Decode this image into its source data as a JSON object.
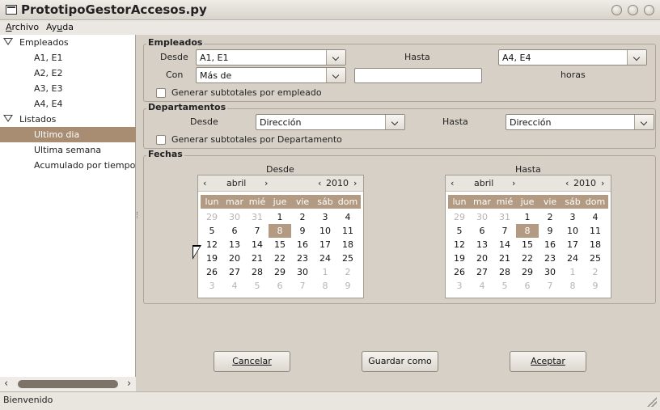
{
  "window": {
    "title": "PrototipoGestorAccesos.py"
  },
  "menu": [
    {
      "label": "Archivo",
      "mnemonic": "A",
      "rest": "rchivo"
    },
    {
      "label": "Ayuda",
      "mnemonic": "u",
      "pre": "Ay",
      "rest": "da"
    }
  ],
  "tree": {
    "empleados": "Empleados",
    "empleados_children": [
      "A1, E1",
      "A2, E2",
      "A3, E3",
      "A4, E4"
    ],
    "listados": "Listados",
    "listados_children": [
      "Ultimo dia",
      "Ultima semana",
      "Acumulado por tiempo"
    ],
    "selected": "Ultimo dia"
  },
  "empleados": {
    "title": "Empleados",
    "desde_label": "Desde",
    "desde_value": "A1, E1",
    "hasta_label": "Hasta",
    "hasta_value": "A4, E4",
    "con_label": "Con",
    "con_value": "Más de",
    "horas_value": "",
    "horas_label": "horas",
    "subtotales_label": "Generar subtotales por empleado"
  },
  "departamentos": {
    "title": "Departamentos",
    "desde_label": "Desde",
    "desde_value": "Dirección",
    "hasta_label": "Hasta",
    "hasta_value": "Dirección",
    "subtotales_label": "Generar subtotales por Departamento"
  },
  "fechas": {
    "title": "Fechas",
    "desde_label": "Desde",
    "hasta_label": "Hasta",
    "month": "abril",
    "year": "2010",
    "day_names": [
      "lun",
      "mar",
      "mié",
      "jue",
      "vie",
      "sáb",
      "dom"
    ],
    "weeks": [
      [
        "29",
        "30",
        "31",
        "1",
        "2",
        "3",
        "4"
      ],
      [
        "5",
        "6",
        "7",
        "8",
        "9",
        "10",
        "11"
      ],
      [
        "12",
        "13",
        "14",
        "15",
        "16",
        "17",
        "18"
      ],
      [
        "19",
        "20",
        "21",
        "22",
        "23",
        "24",
        "25"
      ],
      [
        "26",
        "27",
        "28",
        "29",
        "30",
        "1",
        "2"
      ],
      [
        "3",
        "4",
        "5",
        "6",
        "7",
        "8",
        "9"
      ]
    ],
    "selected_day": "8"
  },
  "buttons": {
    "cancel": "Cancelar",
    "save_as": "Guardar como",
    "accept": "Aceptar"
  },
  "status": {
    "text": "Bienvenido"
  },
  "colors": {
    "selection": "#a88d73",
    "calendar_header": "#b39a82",
    "window_bg": "#d6d0c6"
  }
}
